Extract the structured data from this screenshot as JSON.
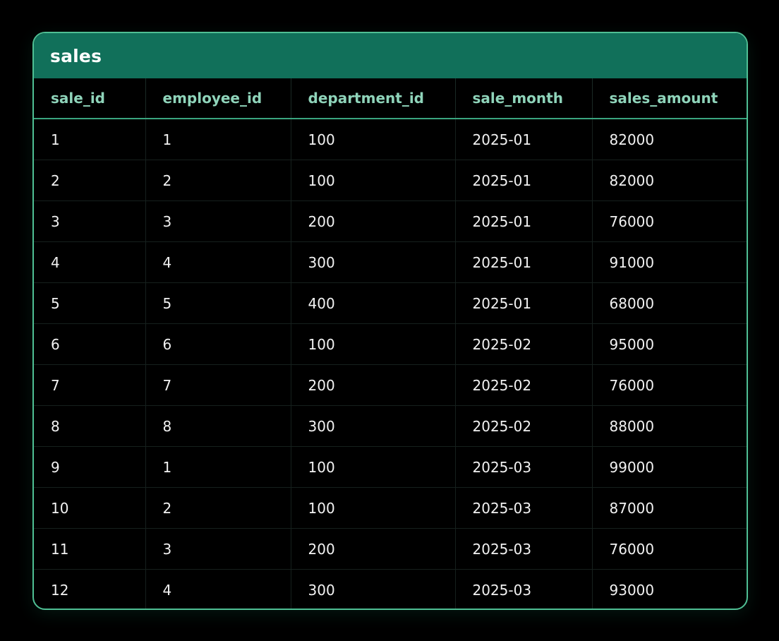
{
  "table": {
    "title": "sales",
    "columns": [
      "sale_id",
      "employee_id",
      "department_id",
      "sale_month",
      "sales_amount"
    ],
    "rows": [
      [
        "1",
        "1",
        "100",
        "2025-01",
        "82000"
      ],
      [
        "2",
        "2",
        "100",
        "2025-01",
        "82000"
      ],
      [
        "3",
        "3",
        "200",
        "2025-01",
        "76000"
      ],
      [
        "4",
        "4",
        "300",
        "2025-01",
        "91000"
      ],
      [
        "5",
        "5",
        "400",
        "2025-01",
        "68000"
      ],
      [
        "6",
        "6",
        "100",
        "2025-02",
        "95000"
      ],
      [
        "7",
        "7",
        "200",
        "2025-02",
        "76000"
      ],
      [
        "8",
        "8",
        "300",
        "2025-02",
        "88000"
      ],
      [
        "9",
        "1",
        "100",
        "2025-03",
        "99000"
      ],
      [
        "10",
        "2",
        "100",
        "2025-03",
        "87000"
      ],
      [
        "11",
        "3",
        "200",
        "2025-03",
        "76000"
      ],
      [
        "12",
        "4",
        "300",
        "2025-03",
        "93000"
      ]
    ]
  },
  "colors": {
    "border": "#4fbf94",
    "title_bar": "#11705a",
    "header_text": "#8fd4ba",
    "cell_text": "#f2f2f2",
    "background": "#000000"
  }
}
